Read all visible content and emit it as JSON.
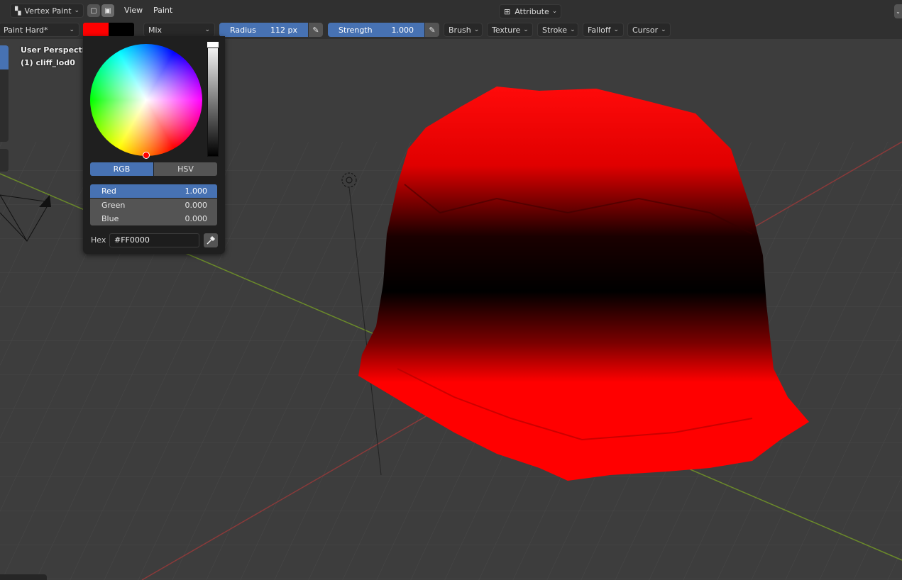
{
  "header": {
    "mode": "Vertex Paint",
    "menus": [
      "View",
      "Paint"
    ],
    "attribute_label": "Attribute"
  },
  "toolbar": {
    "brush_name": "Paint Hard*",
    "primary_color": "#FF0000",
    "secondary_color": "#000000",
    "blend_mode": "Mix",
    "radius_label": "Radius",
    "radius_value": "112 px",
    "strength_label": "Strength",
    "strength_value": "1.000",
    "dropdowns": [
      "Brush",
      "Texture",
      "Stroke",
      "Falloff",
      "Cursor"
    ]
  },
  "viewport": {
    "view_name": "User Perspective",
    "object_name": "(1) cliff_lod0"
  },
  "color_picker": {
    "tabs": [
      "RGB",
      "HSV"
    ],
    "active_tab": "RGB",
    "channels": [
      {
        "label": "Red",
        "value": "1.000"
      },
      {
        "label": "Green",
        "value": "0.000"
      },
      {
        "label": "Blue",
        "value": "0.000"
      }
    ],
    "hex_label": "Hex",
    "hex_value": "#FF0000"
  },
  "colors": {
    "accent": "#4772b3",
    "panel": "#303030",
    "mesh_paint": "#ff0000"
  }
}
